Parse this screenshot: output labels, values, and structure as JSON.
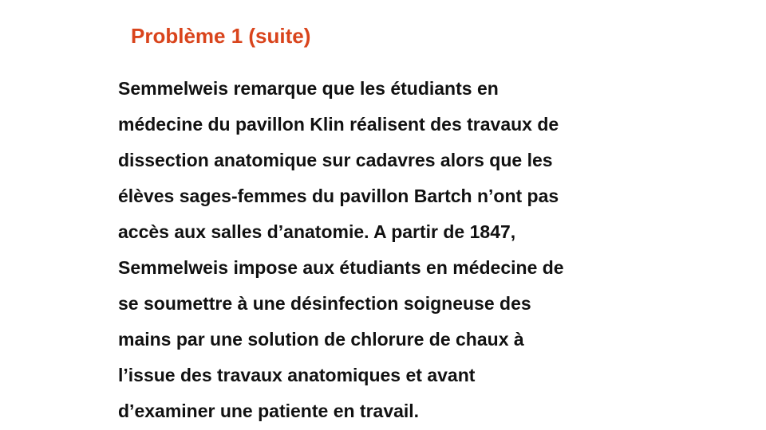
{
  "slide": {
    "title": "Problème 1 (suite)",
    "title_color": "#d9441c",
    "text_color": "#111111",
    "body_lines": [
      "Semmelweis remarque que les étudiants en",
      "médecine du pavillon Klin réalisent des travaux de",
      "dissection anatomique sur cadavres alors que les",
      "élèves sages-femmes du pavillon Bartch n’ont pas",
      "accès aux salles d’anatomie. A partir de 1847,",
      "Semmelweis impose aux étudiants en médecine de",
      "se soumettre à une désinfection soigneuse des",
      "mains par une solution de chlorure de chaux à",
      "l’issue des travaux anatomiques et avant",
      "d’examiner une patiente en travail."
    ]
  }
}
